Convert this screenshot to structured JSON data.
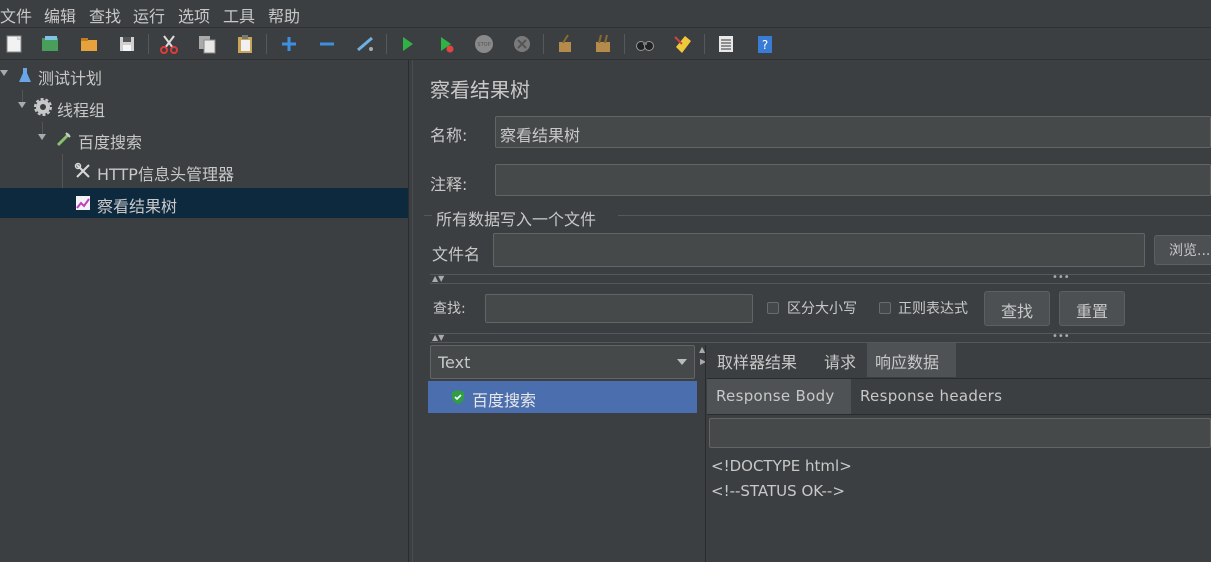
{
  "menu": [
    "文件",
    "编辑",
    "查找",
    "运行",
    "选项",
    "工具",
    "帮助"
  ],
  "toolbar": {
    "icons": [
      "new-icon",
      "templates-icon",
      "open-icon",
      "save-icon",
      "cut-icon",
      "copy-icon",
      "paste-icon",
      "expand-icon",
      "collapse-icon",
      "toggle-icon",
      "start-icon",
      "start-no-pause-icon",
      "stop-icon",
      "shutdown-icon",
      "clear-icon",
      "clear-all-icon",
      "search-icon",
      "reset-search-icon",
      "function-helper-icon",
      "help-icon"
    ]
  },
  "tree": {
    "items": [
      {
        "label": "测试计划",
        "icon": "flask-icon"
      },
      {
        "label": "线程组",
        "icon": "gear-icon"
      },
      {
        "label": "百度搜索",
        "icon": "pipette-icon"
      },
      {
        "label": "HTTP信息头管理器",
        "icon": "wrench-icon"
      },
      {
        "label": "察看结果树",
        "icon": "chart-icon"
      }
    ]
  },
  "panel": {
    "title": "察看结果树",
    "name_label": "名称:",
    "name_value": "察看结果树",
    "comment_label": "注释:",
    "comment_value": "",
    "file_group_title": "所有数据写入一个文件",
    "filename_label": "文件名",
    "filename_value": "",
    "browse_button": "浏览...",
    "search_label": "查找:",
    "search_value": "",
    "case_label": "区分大小写",
    "regex_label": "正则表达式",
    "find_button": "查找",
    "reset_button": "重置"
  },
  "results": {
    "renderer": "Text",
    "samples": [
      {
        "label": "百度搜索",
        "status": "success"
      }
    ],
    "tabs": [
      "取样器结果",
      "请求",
      "响应数据"
    ],
    "active_tab": "响应数据",
    "subtabs": [
      "Response Body",
      "Response headers"
    ],
    "active_subtab": "Response Body",
    "response_search_value": "",
    "body_lines": [
      "<!DOCTYPE html>",
      "<!--STATUS OK-->"
    ]
  },
  "colors": {
    "background": "#3c3f41",
    "selection": "#0d293e",
    "list_selection": "#4b6eaf",
    "text": "#c8c8c8"
  }
}
